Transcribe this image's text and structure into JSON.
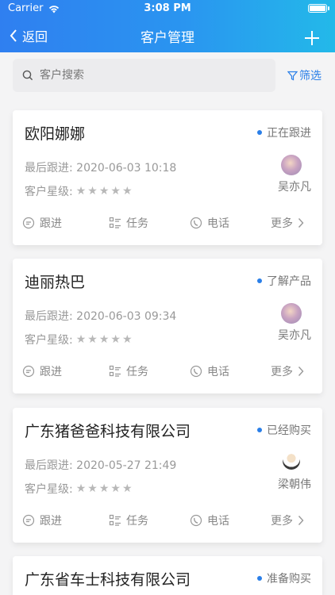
{
  "status_bar": {
    "carrier": "Carrier",
    "time": "3:08 PM"
  },
  "nav": {
    "back_label": "返回",
    "title": "客户管理",
    "add_icon": "plus-icon"
  },
  "search": {
    "placeholder": "客户搜索",
    "value": "",
    "filter_label": "筛选"
  },
  "customers": [
    {
      "name": "欧阳娜娜",
      "status": "正在跟进",
      "last_follow_label": "最后跟进:",
      "last_follow": "2020-06-03 10:18",
      "rating_label": "客户星级:",
      "rating": 5,
      "owner": "吴亦凡",
      "actions": {
        "follow": "跟进",
        "task": "任务",
        "call": "电话",
        "more": "更多"
      }
    },
    {
      "name": "迪丽热巴",
      "status": "了解产品",
      "last_follow_label": "最后跟进:",
      "last_follow": "2020-06-03 09:34",
      "rating_label": "客户星级:",
      "rating": 5,
      "owner": "吴亦凡",
      "actions": {
        "follow": "跟进",
        "task": "任务",
        "call": "电话",
        "more": "更多"
      }
    },
    {
      "name": "广东猪爸爸科技有限公司",
      "status": "已经购买",
      "last_follow_label": "最后跟进:",
      "last_follow": "2020-05-27 21:49",
      "rating_label": "客户星级:",
      "rating": 5,
      "owner": "梁朝伟",
      "actions": {
        "follow": "跟进",
        "task": "任务",
        "call": "电话",
        "more": "更多"
      }
    },
    {
      "name": "广东省车士科技有限公司",
      "status": "准备购买"
    }
  ],
  "colors": {
    "accent": "#2a7fe8",
    "header_start": "#2f7ff0",
    "header_end": "#23b9e9",
    "star": "#b8b8b8"
  }
}
